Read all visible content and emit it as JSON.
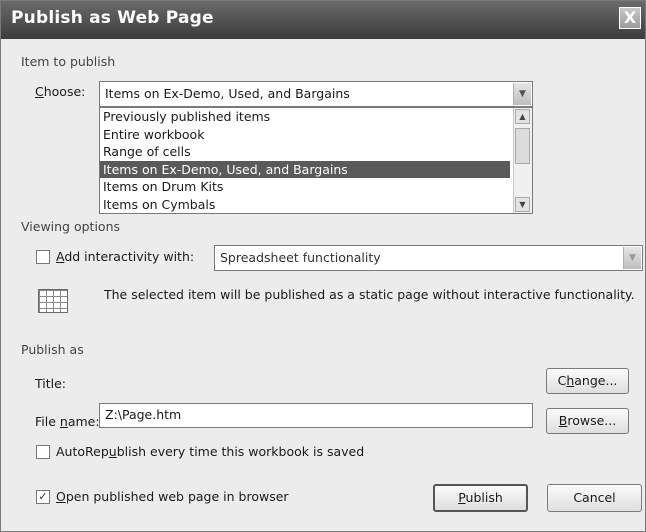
{
  "dialog": {
    "title": "Publish as Web Page",
    "close_glyph": "X"
  },
  "item_to_publish": {
    "section_label": "Item to publish",
    "choose_label_prefix": "",
    "choose_label_ul": "C",
    "choose_label_rest": "hoose:",
    "choose_value": "Items on Ex-Demo, Used, and Bargains",
    "list_items": [
      "Previously published items",
      "Entire workbook",
      "Range of cells",
      "Items on Ex-Demo, Used, and Bargains",
      "Items on Drum Kits",
      "Items on Cymbals"
    ],
    "selected_index": 3
  },
  "viewing_options": {
    "section_label": "Viewing options",
    "interactivity_checked": false,
    "interactivity_label_ul": "A",
    "interactivity_label_rest": "dd interactivity with:",
    "interactivity_value": "Spreadsheet functionality",
    "description": "The selected item will be published as a static page without interactive functionality.",
    "icon": "spreadsheet-grid-icon"
  },
  "publish_as": {
    "section_label": "Publish as",
    "title_label": "Title:",
    "change_button_pre": "C",
    "change_button_ul": "h",
    "change_button_rest": "ange...",
    "filename_label_pre": "File ",
    "filename_label_ul": "n",
    "filename_label_rest": "ame:",
    "filename_value": "Z:\\Page.htm",
    "browse_button_ul": "B",
    "browse_button_rest": "rowse...",
    "autorepublish_checked": false,
    "autorepublish_pre": "AutoRep",
    "autorepublish_ul": "u",
    "autorepublish_rest": "blish every time this workbook is saved",
    "open_in_browser_checked": true,
    "open_in_browser_ul": "O",
    "open_in_browser_rest": "pen published web page in browser"
  },
  "buttons": {
    "publish_ul": "P",
    "publish_rest": "ublish",
    "cancel_label": "Cancel"
  }
}
